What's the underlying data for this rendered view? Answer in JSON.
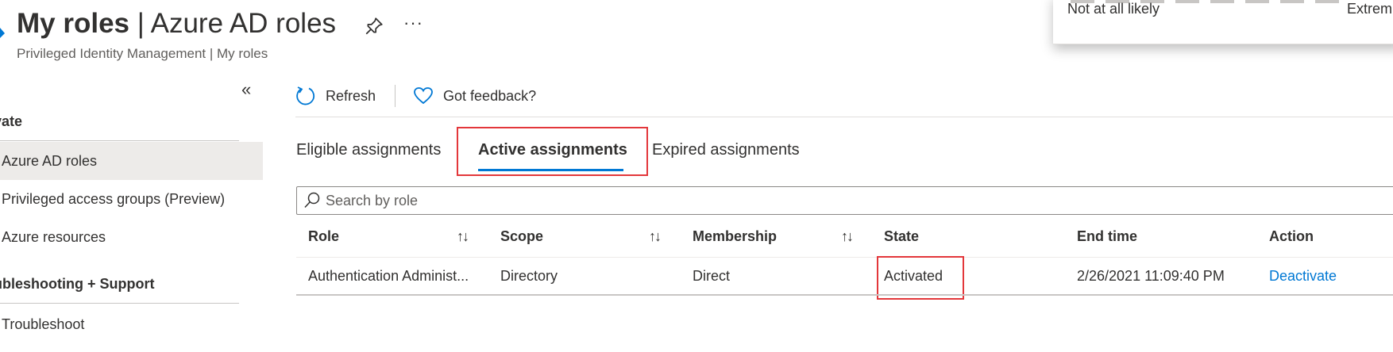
{
  "header": {
    "title_bold": "My roles",
    "title_rest": " | Azure AD roles",
    "breadcrumb": "Privileged Identity Management | My roles",
    "more_label": "···"
  },
  "feedback_popup": {
    "low_label": "Not at all likely",
    "high_label": "Extrem"
  },
  "sidebar": {
    "collapse_glyph": "«",
    "sections": [
      {
        "label": "vate"
      },
      {
        "label": "ubleshooting + Support"
      }
    ],
    "items": [
      {
        "label": "Azure AD roles",
        "selected": true
      },
      {
        "label": "Privileged access groups (Preview)"
      },
      {
        "label": "Azure resources"
      },
      {
        "label": "Troubleshoot"
      }
    ]
  },
  "toolbar": {
    "refresh_label": "Refresh",
    "feedback_label": "Got feedback?"
  },
  "tabs": [
    {
      "label": "Eligible assignments"
    },
    {
      "label": "Active assignments",
      "active": true
    },
    {
      "label": "Expired assignments"
    }
  ],
  "search": {
    "placeholder": "Search by role"
  },
  "table": {
    "columns": [
      "Role",
      "Scope",
      "Membership",
      "State",
      "End time",
      "Action"
    ],
    "sort_glyph": "↑↓",
    "rows": [
      {
        "role": "Authentication Administ...",
        "scope": "Directory",
        "membership": "Direct",
        "state": "Activated",
        "end_time": "2/26/2021 11:09:40 PM",
        "action": "Deactivate"
      }
    ]
  },
  "colors": {
    "accent": "#0078d4",
    "highlight": "#e3373b",
    "selected_bg": "#edebe9"
  }
}
